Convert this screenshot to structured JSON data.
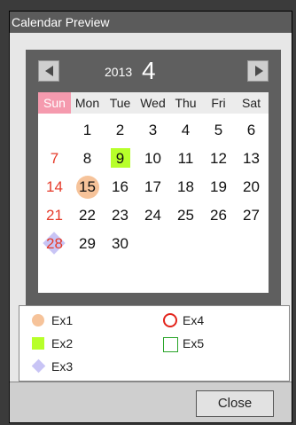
{
  "window": {
    "title": "Calendar Preview"
  },
  "calendar": {
    "year": "2013",
    "month": "4",
    "nav_prev_icon": "prev-arrow-icon",
    "nav_next_icon": "next-arrow-icon",
    "days_of_week": [
      "Sun",
      "Mon",
      "Tue",
      "Wed",
      "Thu",
      "Fri",
      "Sat"
    ],
    "weeks": [
      [
        "",
        "1",
        "2",
        "3",
        "4",
        "5",
        "6"
      ],
      [
        "7",
        "8",
        "9",
        "10",
        "11",
        "12",
        "13"
      ],
      [
        "14",
        "15",
        "16",
        "17",
        "18",
        "19",
        "20"
      ],
      [
        "21",
        "22",
        "23",
        "24",
        "25",
        "26",
        "27"
      ],
      [
        "28",
        "29",
        "30",
        "",
        "",
        "",
        ""
      ]
    ],
    "marked_days": [
      {
        "day": "9",
        "marker": "Ex2"
      },
      {
        "day": "15",
        "marker": "Ex1"
      },
      {
        "day": "28",
        "marker": "Ex3"
      }
    ],
    "colors": {
      "sunday_header": "#f59aae",
      "sunday_text": "#e63b2a",
      "ex1": "#f6c39a",
      "ex2": "#b7ff2a",
      "ex3": "#c8c4f5",
      "ex4": "#e3241b",
      "ex5": "#2aa52a"
    }
  },
  "legend": {
    "items": [
      {
        "label": "Ex1",
        "icon": "filled-circle-icon"
      },
      {
        "label": "Ex2",
        "icon": "filled-square-icon"
      },
      {
        "label": "Ex3",
        "icon": "diamond-icon"
      },
      {
        "label": "Ex4",
        "icon": "ring-circle-icon"
      },
      {
        "label": "Ex5",
        "icon": "outline-square-icon"
      }
    ]
  },
  "footer": {
    "close_label": "Close"
  }
}
